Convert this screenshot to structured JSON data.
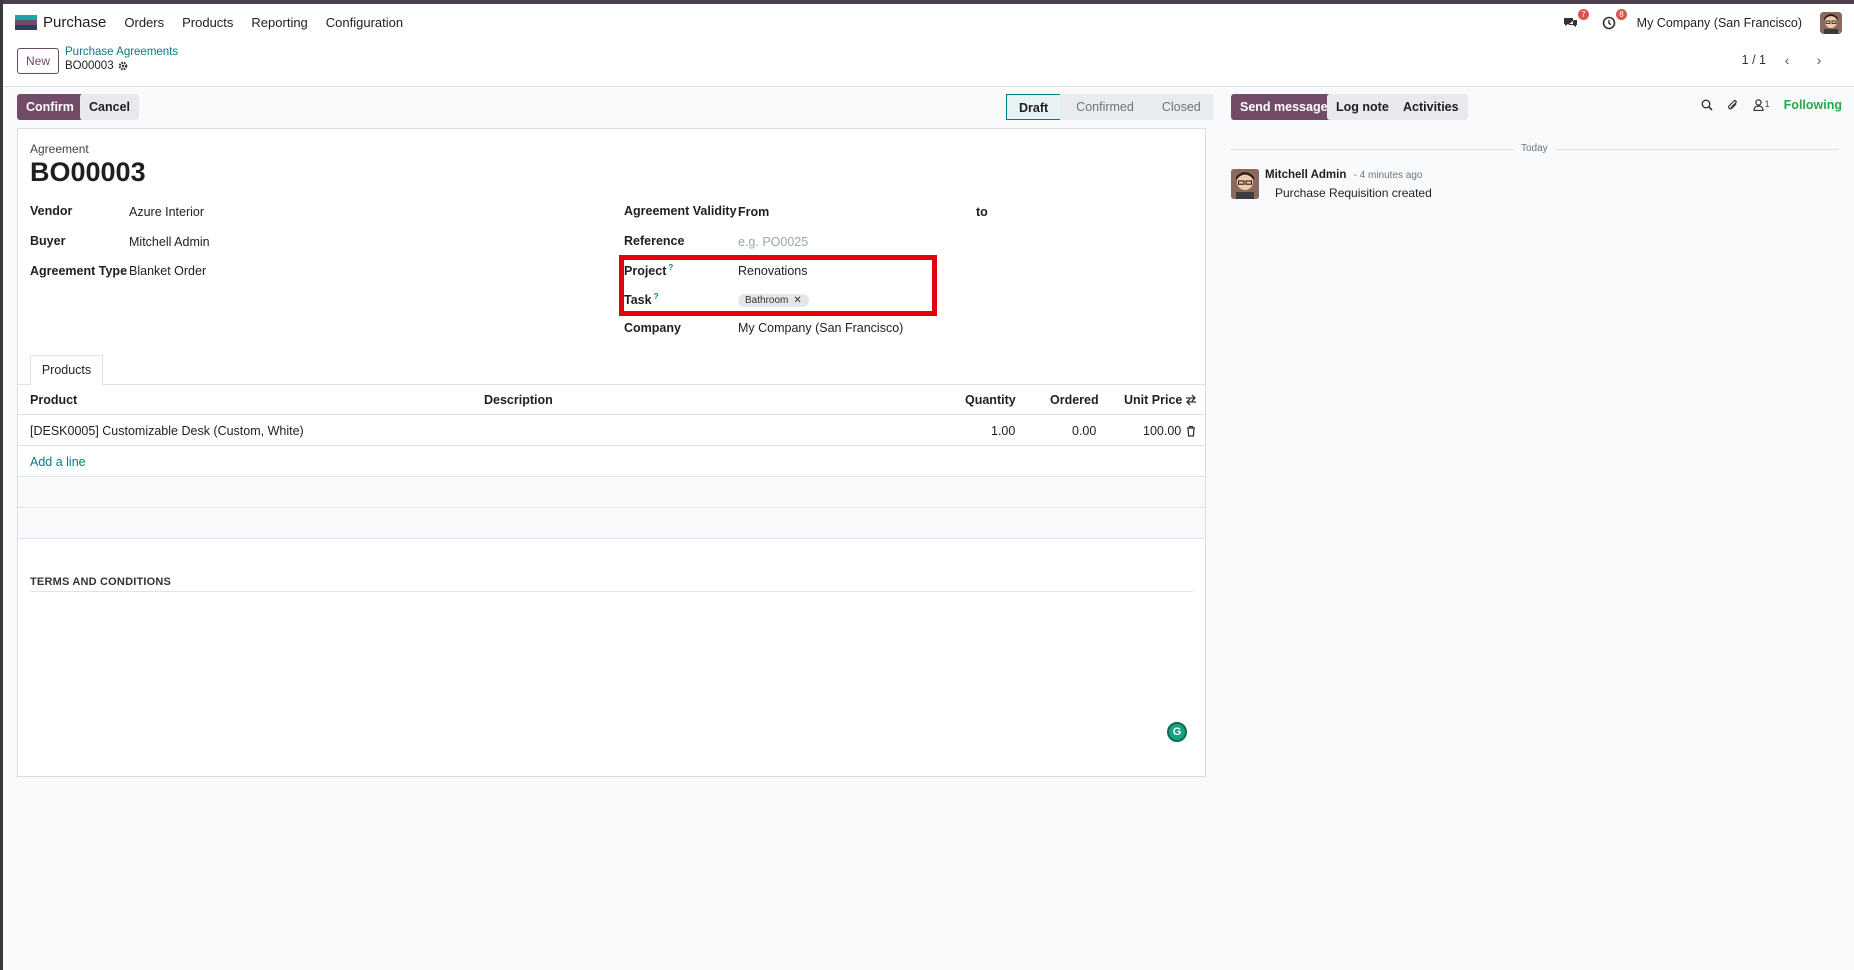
{
  "navbar": {
    "app_name": "Purchase",
    "menu": [
      "Orders",
      "Products",
      "Reporting",
      "Configuration"
    ],
    "messages_count": "7",
    "activities_count": "8",
    "company": "My Company (San Francisco)",
    "brand_colors": [
      "#1ea5a8",
      "#714b67",
      "#2d3f5c"
    ]
  },
  "control_panel": {
    "new_label": "New",
    "breadcrumb_parent": "Purchase Agreements",
    "breadcrumb_current": "BO00003",
    "pager": "1 / 1"
  },
  "actions": {
    "confirm": "Confirm",
    "cancel": "Cancel"
  },
  "statusbar": {
    "steps": [
      "Draft",
      "Confirmed",
      "Closed"
    ],
    "active": "Draft"
  },
  "form": {
    "title_label": "Agreement",
    "title": "BO00003",
    "vendor_label": "Vendor",
    "vendor": "Azure Interior",
    "buyer_label": "Buyer",
    "buyer": "Mitchell Admin",
    "type_label": "Agreement Type",
    "type": "Blanket Order",
    "validity_label": "Agreement Validity",
    "validity_from": "From",
    "validity_to": "to",
    "reference_label": "Reference",
    "reference_placeholder": "e.g. PO0025",
    "project_label": "Project",
    "project": "Renovations",
    "task_label": "Task",
    "task_tag": "Bathroom",
    "help_mark": "?",
    "company_label": "Company",
    "company": "My Company (San Francisco)",
    "highlight_color": "#e3000f"
  },
  "tabs": {
    "products": "Products"
  },
  "table": {
    "headers": {
      "product": "Product",
      "description": "Description",
      "quantity": "Quantity",
      "ordered": "Ordered",
      "unit_price": "Unit Price"
    },
    "rows": [
      {
        "product": "[DESK0005] Customizable Desk (Custom, White)",
        "description": "",
        "quantity": "1.00",
        "ordered": "0.00",
        "unit_price": "100.00"
      }
    ],
    "add_line": "Add a line"
  },
  "terms": {
    "title": "TERMS AND CONDITIONS"
  },
  "chatter": {
    "send_message": "Send message",
    "log_note": "Log note",
    "activities": "Activities",
    "followers_count": "1",
    "following": "Following",
    "date_separator": "Today",
    "messages": [
      {
        "author": "Mitchell Admin",
        "time": "- 4 minutes ago",
        "body": "Purchase Requisition created"
      }
    ]
  }
}
